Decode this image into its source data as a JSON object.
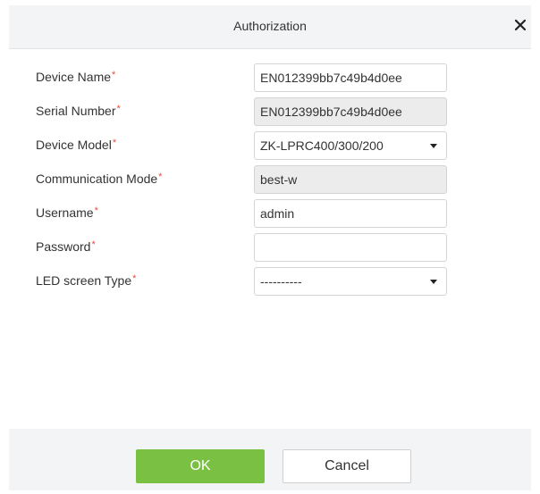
{
  "dialog": {
    "title": "Authorization",
    "close_icon": "close-icon"
  },
  "form": {
    "fields": [
      {
        "label": "Device Name",
        "required_mark": "*",
        "value": "EN012399bb7c49b4d0ee",
        "type": "text"
      },
      {
        "label": "Serial Number",
        "required_mark": "*",
        "value": "EN012399bb7c49b4d0ee",
        "type": "readonly"
      },
      {
        "label": "Device Model",
        "required_mark": "*",
        "value": "ZK-LPRC400/300/200",
        "type": "select"
      },
      {
        "label": "Communication Mode",
        "required_mark": "*",
        "value": "best-w",
        "type": "readonly"
      },
      {
        "label": "Username",
        "required_mark": "*",
        "value": "admin",
        "type": "text"
      },
      {
        "label": "Password",
        "required_mark": "*",
        "value": "",
        "type": "password"
      },
      {
        "label": "LED screen Type",
        "required_mark": "*",
        "value": "----------",
        "type": "select"
      }
    ]
  },
  "footer": {
    "ok_label": "OK",
    "cancel_label": "Cancel"
  },
  "colors": {
    "ok_button": "#7ac143",
    "required_mark": "#e84c3d",
    "header_bg": "#f3f4f6",
    "disabled_field_bg": "#ececec"
  }
}
